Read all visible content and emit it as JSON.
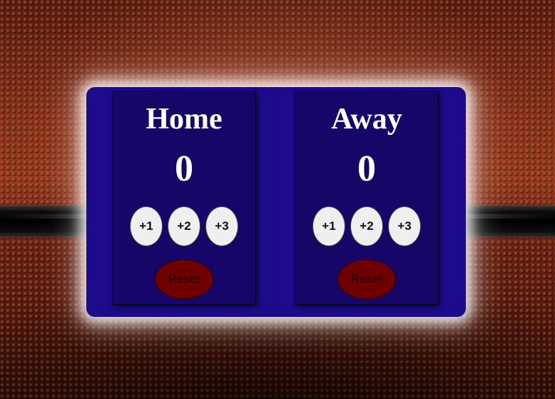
{
  "colors": {
    "panel_background": "#1d0b8c",
    "team_card_background": "#160667",
    "point_button": "#efefef",
    "reset_button": "#6e0000"
  },
  "background": {
    "icon": "basketball-texture"
  },
  "teams": [
    {
      "name": "Home",
      "score": "0",
      "buttons": [
        "+1",
        "+2",
        "+3"
      ],
      "reset_label": "Reset"
    },
    {
      "name": "Away",
      "score": "0",
      "buttons": [
        "+1",
        "+2",
        "+3"
      ],
      "reset_label": "Reset"
    }
  ]
}
